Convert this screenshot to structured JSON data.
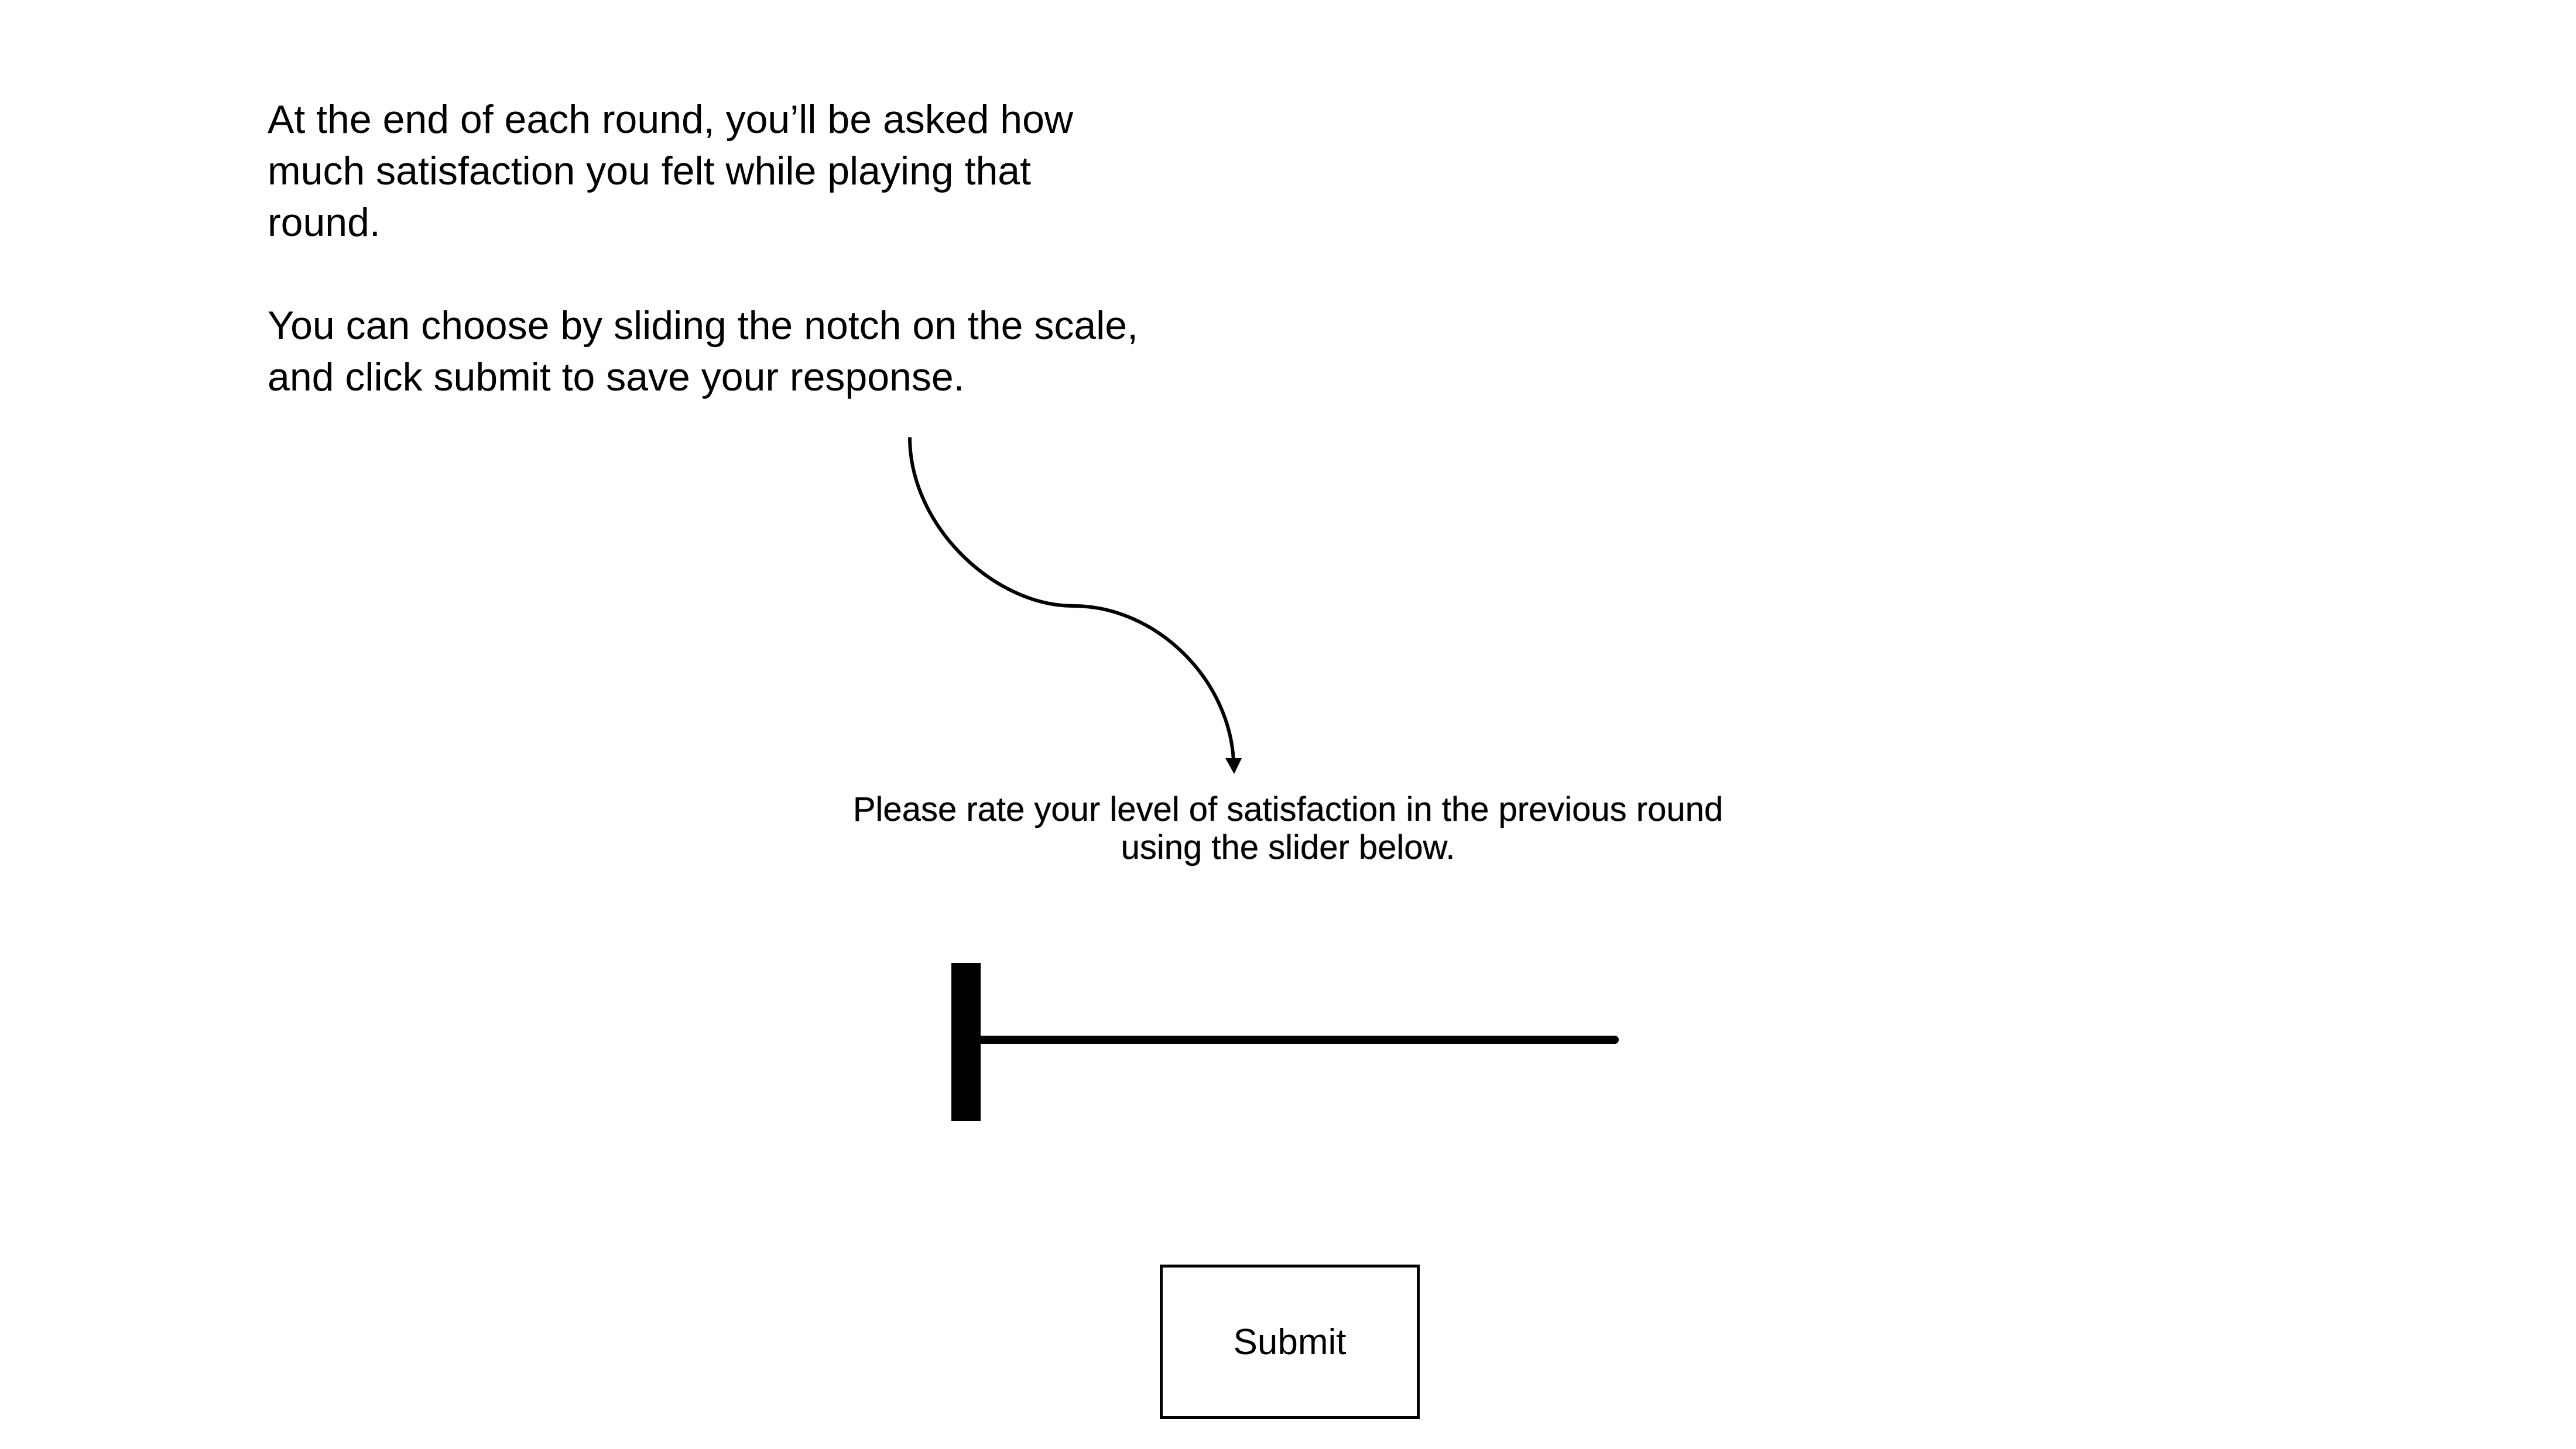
{
  "instructions": {
    "paragraph1": "At the end of each round, you’ll be asked how much satisfaction you felt while playing that round.",
    "paragraph2": "You can choose by sliding the notch on the scale, and click submit to save your response."
  },
  "prompt": {
    "line1": "Please rate your level of satisfaction in the previous round",
    "line2": "using the slider below."
  },
  "slider": {
    "value_fraction": 0
  },
  "submit": {
    "label": "Submit"
  }
}
